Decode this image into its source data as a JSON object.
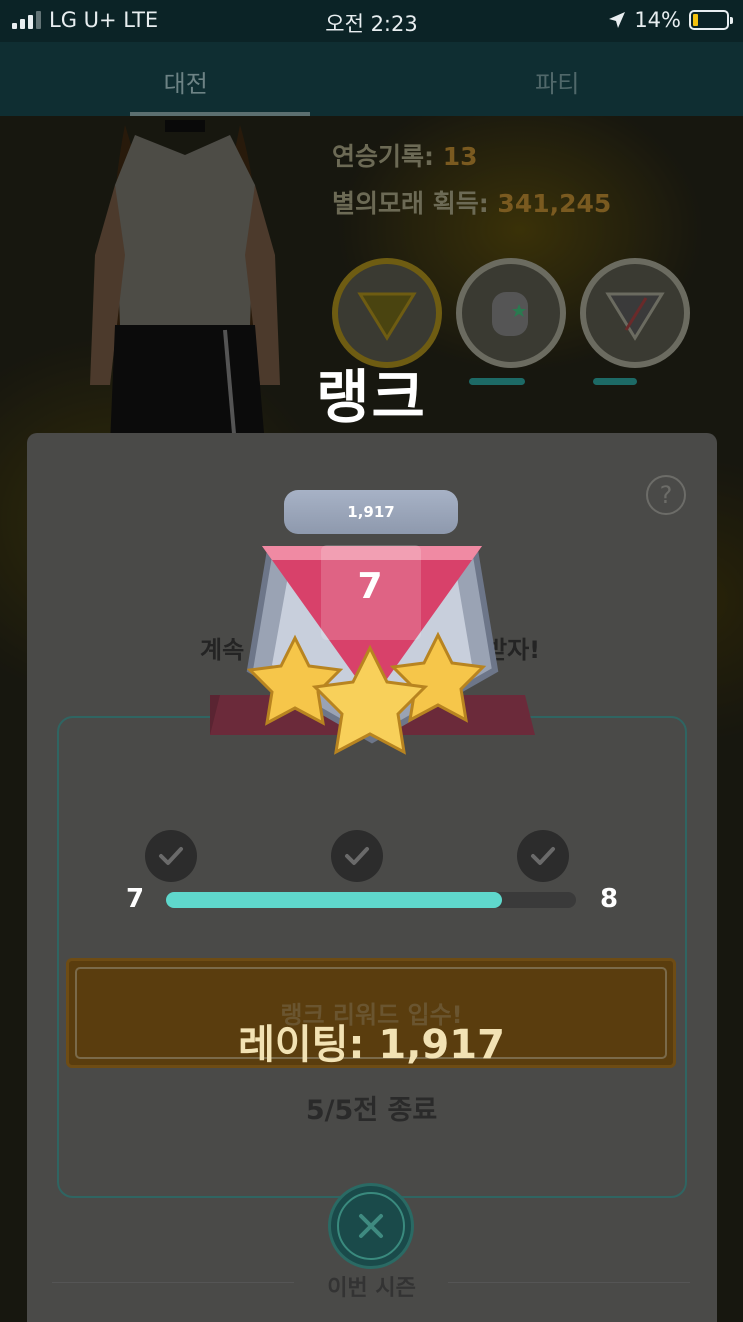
{
  "status_bar": {
    "carrier": "LG U+  LTE",
    "time": "오전 2:23",
    "battery_percent": "14%",
    "battery_level": 0.14
  },
  "tabs": [
    {
      "label": "대전",
      "active": true
    },
    {
      "label": "파티",
      "active": false
    }
  ],
  "stats": {
    "streak_label": "연승기록:",
    "streak_value": "13",
    "stardust_label": "별의모래 획득:",
    "stardust_value": "341,245"
  },
  "rank_title": "랭크",
  "badge": {
    "rating_pill": "1,917",
    "rank": "7",
    "stars": 3
  },
  "panel": {
    "help": "?",
    "keep_left": "계속",
    "keep_right": "받자!",
    "progress": {
      "from": "7",
      "to": "8",
      "fraction": 0.82,
      "checks_completed": 3
    },
    "reward_button": "랭크 리워드 입수!",
    "rating_text": "레이팅: 1,917",
    "battles": "5/5전 종료",
    "season": "이번 시즌"
  },
  "colors": {
    "progress_fill": "#5fd8cc",
    "rank_triangle": "#d8416a",
    "star": "#f6c64a"
  }
}
